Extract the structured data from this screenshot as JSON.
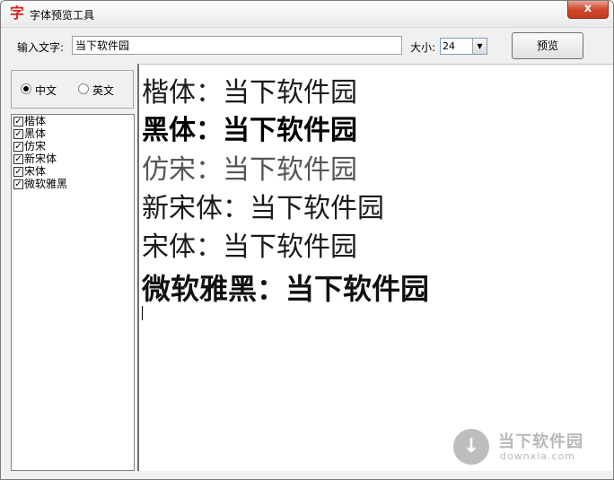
{
  "window": {
    "app_icon": "字",
    "title": "字体预览工具",
    "close_symbol": "x"
  },
  "toolbar": {
    "input_label": "输入文字:",
    "input_value": "当下软件园",
    "size_label": "大小:",
    "size_value": "24",
    "preview_label": "预览"
  },
  "language": {
    "options": [
      {
        "label": "中文",
        "selected": true
      },
      {
        "label": "英文",
        "selected": false
      }
    ]
  },
  "font_list": [
    {
      "name": "楷体",
      "checked": true
    },
    {
      "name": "黑体",
      "checked": true
    },
    {
      "name": "仿宋",
      "checked": true
    },
    {
      "name": "新宋体",
      "checked": true
    },
    {
      "name": "宋体",
      "checked": true
    },
    {
      "name": "微软雅黑",
      "checked": true
    }
  ],
  "preview_lines": [
    "楷体：当下软件园",
    "黑体：当下软件园",
    "仿宋：当下软件园",
    "新宋体：当下软件园",
    "宋体：当下软件园",
    "微软雅黑：当下软件园"
  ],
  "watermark": {
    "name": "当下软件园",
    "url": "downxia.com"
  }
}
